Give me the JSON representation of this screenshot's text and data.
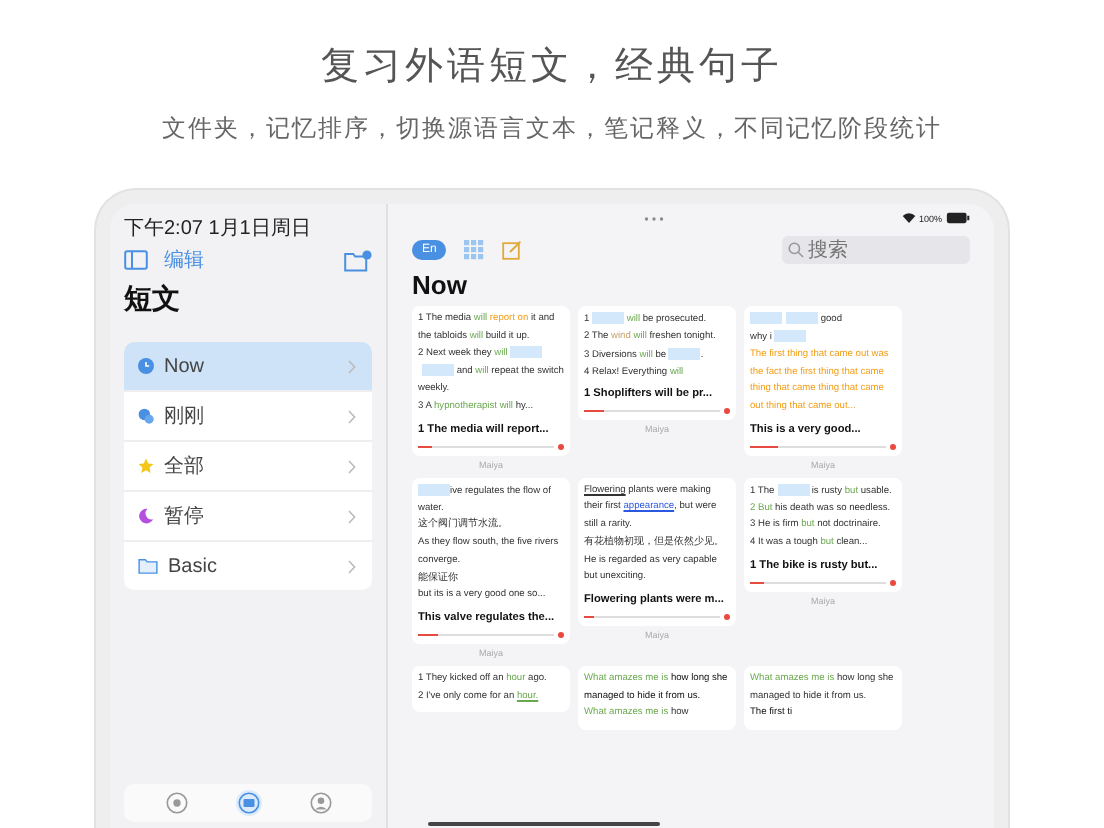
{
  "headline": "复习外语短文，经典句子",
  "subtitle": "文件夹，记忆排序，切换源语言文本，笔记释义，不同记忆阶段统计",
  "status_bar": {
    "time": "下午2:07  1月1日周日",
    "battery": "100%"
  },
  "sidebar": {
    "edit": "编辑",
    "title": "短文",
    "items": [
      {
        "label": "Now",
        "kind": "clock",
        "selected": true
      },
      {
        "label": "刚刚",
        "kind": "people",
        "selected": false
      },
      {
        "label": "全部",
        "kind": "star",
        "selected": false
      },
      {
        "label": "暂停",
        "kind": "moon",
        "selected": false
      },
      {
        "label": "Basic",
        "kind": "folder",
        "selected": false
      }
    ],
    "tabs": [
      {
        "kind": "record",
        "selected": false
      },
      {
        "kind": "cards",
        "selected": true
      },
      {
        "kind": "person",
        "selected": false
      }
    ]
  },
  "toolbar": {
    "language": {
      "label": "En",
      "selected": true
    },
    "search": {
      "placeholder": "搜索"
    }
  },
  "title": "Now",
  "cards": [
    {
      "paragraphs": [
        [
          {
            "kind": "plain",
            "text": "1   The media "
          },
          {
            "kind": "green",
            "text": "will"
          },
          {
            "kind": "orange",
            "text": " report on"
          },
          {
            "kind": "plain",
            "text": " it and the tabloids "
          },
          {
            "kind": "green",
            "text": "will"
          },
          {
            "kind": "plain",
            "text": " build it up."
          }
        ],
        [
          {
            "kind": "plain",
            "text": " 2   Next week they "
          },
          {
            "kind": "green",
            "text": "will "
          },
          {
            "kind": "blank"
          },
          {
            "kind": "blank"
          },
          {
            "kind": "plain",
            "text": " and "
          },
          {
            "kind": "green",
            "text": "will"
          },
          {
            "kind": "plain",
            "text": " repeat the switch weekly."
          }
        ],
        [
          {
            "kind": "plain",
            "text": " 3   A "
          },
          {
            "kind": "green",
            "text": "hypnotherapist will"
          },
          {
            "kind": "plain",
            "text": " hy..."
          }
        ]
      ],
      "heading": "1   The media will report...",
      "level": 0.1,
      "author": "Maiya"
    },
    {
      "paragraphs": [
        [
          {
            "kind": "plain",
            "text": "1   "
          },
          {
            "kind": "blank"
          },
          {
            "kind": "green",
            "text": " will"
          },
          {
            "kind": "plain",
            "text": " be prosecuted."
          }
        ],
        [
          {
            "kind": "plain",
            "text": " 2   The "
          },
          {
            "kind": "tan",
            "text": "wind"
          },
          {
            "kind": "green",
            "text": " will"
          },
          {
            "kind": "plain",
            "text": " freshen tonight."
          }
        ],
        [
          {
            "kind": "plain",
            "text": " 3   Diversions "
          },
          {
            "kind": "green",
            "text": "will"
          },
          {
            "kind": "plain",
            "text": " be "
          },
          {
            "kind": "blank"
          },
          {
            "kind": "plain",
            "text": "."
          }
        ],
        [
          {
            "kind": "plain",
            "text": " 4   Relax! Everything "
          },
          {
            "kind": "green",
            "text": "will"
          }
        ]
      ],
      "heading": "1   Shoplifters will be pr...",
      "level": 0.15,
      "author": "Maiya"
    },
    {
      "paragraphs": [
        [
          {
            "kind": "blank"
          },
          {
            "kind": "blank"
          },
          {
            "kind": "plain",
            "text": " good"
          }
        ],
        [
          {
            "kind": "plain",
            "text": " why i "
          },
          {
            "kind": "blank"
          }
        ],
        [
          {
            "kind": "orange",
            "text": " The first thing that came out was the fact the first thing that came thing that came thing that came out thing that came out..."
          }
        ]
      ],
      "heading": "This is a very  good...",
      "level": 0.2,
      "author": "Maiya"
    },
    {
      "paragraphs": [
        [
          {
            "kind": "blank"
          },
          {
            "kind": "plain",
            "text": "ive regulates the flow of water."
          }
        ],
        [
          {
            "kind": "plain",
            "text": " 这个阀门调节水流。"
          }
        ],
        [
          {
            "kind": "plain",
            "text": " As they flow south, the five rivers converge."
          }
        ],
        [
          {
            "kind": "plain",
            "text": " 能保证你"
          }
        ],
        [
          {
            "kind": "plain",
            "text": " but its is a very good one so..."
          }
        ]
      ],
      "heading": "This valve regulates the...",
      "level": 0.15,
      "author": "Maiya"
    },
    {
      "paragraphs": [
        [
          {
            "kind": "underline",
            "text": "Flowering"
          },
          {
            "kind": "plain",
            "text": " plants were making their first "
          },
          {
            "kind": "link",
            "text": "appearance"
          },
          {
            "kind": "plain",
            "text": ", but were still a rarity."
          }
        ],
        [
          {
            "kind": "plain",
            "text": " 有花植物初现，但是依然少见。"
          }
        ],
        [
          {
            "kind": "plain",
            "text": " He is regarded as very capable but unexciting."
          }
        ]
      ],
      "heading": "Flowering plants were m...",
      "level": 0.08,
      "author": "Maiya"
    },
    {
      "paragraphs": [
        [
          {
            "kind": "plain",
            "text": "1   The "
          },
          {
            "kind": "blank"
          },
          {
            "kind": "plain",
            "text": " is rusty "
          },
          {
            "kind": "green",
            "text": "but"
          },
          {
            "kind": "plain",
            "text": " usable."
          }
        ],
        [
          {
            "kind": "green",
            "text": " 2   But"
          },
          {
            "kind": "plain",
            "text": " his death was so needless."
          }
        ],
        [
          {
            "kind": "plain",
            "text": " 3   He is firm "
          },
          {
            "kind": "green",
            "text": "but"
          },
          {
            "kind": "plain",
            "text": " not doctrinaire."
          }
        ],
        [
          {
            "kind": "plain",
            "text": " 4   It was a tough "
          },
          {
            "kind": "green",
            "text": "but"
          },
          {
            "kind": "plain",
            "text": " clean..."
          }
        ]
      ],
      "heading": "1   The bike is rusty but...",
      "level": 0.1,
      "author": "Maiya"
    },
    {
      "paragraphs": [
        [
          {
            "kind": "plain",
            "text": "1   They kicked off an "
          },
          {
            "kind": "green",
            "text": "hour"
          },
          {
            "kind": "plain",
            "text": " ago."
          }
        ],
        [
          {
            "kind": "plain",
            "text": " 2   I've only come for an "
          },
          {
            "kind": "greenline",
            "text": "hour."
          }
        ]
      ]
    },
    {
      "paragraphs": [
        [
          {
            "kind": "green",
            "text": "What amazes me is"
          },
          {
            "kind": "bold",
            "text": " how long she managed to hide it from us."
          }
        ],
        [
          {
            "kind": "green",
            "text": " What amazes me is"
          },
          {
            "kind": "plain",
            "text": " how"
          }
        ]
      ]
    },
    {
      "paragraphs": [
        [
          {
            "kind": "green",
            "text": "What amazes me is"
          },
          {
            "kind": "plain",
            "text": " how long she managed to hide it from us."
          }
        ],
        [
          {
            "kind": "bold",
            "text": " The first ti"
          }
        ]
      ]
    }
  ]
}
